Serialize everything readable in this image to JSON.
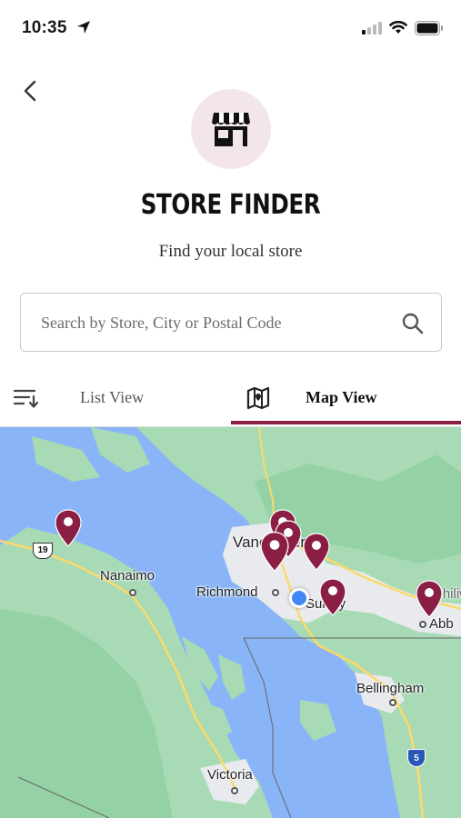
{
  "status_bar": {
    "time": "10:35"
  },
  "header": {
    "title": "STORE FINDER",
    "subtitle": "Find your local store"
  },
  "search": {
    "placeholder": "Search by Store, City or Postal Code",
    "value": ""
  },
  "tabs": [
    {
      "label": "List View",
      "active": false,
      "icon": "sort-list-icon"
    },
    {
      "label": "Map View",
      "active": true,
      "icon": "map-icon"
    }
  ],
  "map": {
    "labels": {
      "nanaimo": "Nanaimo",
      "vancouver": "Vancouver",
      "richmond": "Richmond",
      "surrey": "Surrey",
      "bellingham": "Bellingham",
      "victoria": "Victoria",
      "abbotsford": "Abb",
      "chilliwack": "Chiliwa"
    },
    "highways": {
      "bc19": "19",
      "i5": "5"
    },
    "store_pin_count": 7
  },
  "colors": {
    "accent": "#8a1e45",
    "icon_circle": "#f3e6ea",
    "water": "#8ab4f8",
    "land": "#a8dab5",
    "urban": "#e8eaed",
    "user_location": "#4285f4"
  }
}
